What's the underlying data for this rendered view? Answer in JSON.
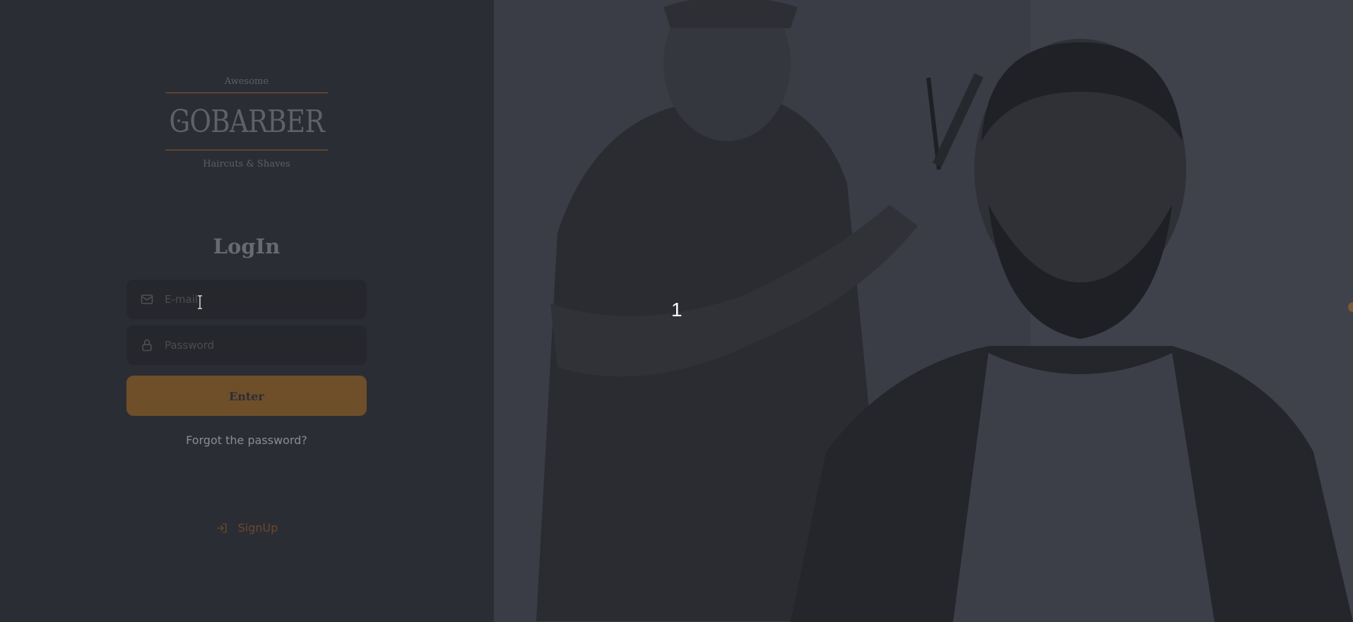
{
  "logo": {
    "top_text": "Awesome",
    "main_text": "GOBARBER",
    "bottom_text": "Haircuts & Shaves"
  },
  "login": {
    "title": "LogIn",
    "email_placeholder": "E-mail",
    "password_placeholder": "Password",
    "submit_label": "Enter",
    "forgot_label": "Forgot the password?",
    "signup_label": "SignUp"
  },
  "overlay": {
    "number": "1"
  },
  "colors": {
    "accent": "#ff9000",
    "accent_dimmed": "#6e4f2a",
    "left_bg": "#2b2d34",
    "input_bg": "#25272d"
  },
  "icons": {
    "email": "mail-icon",
    "password": "lock-icon",
    "signup": "log-in-icon"
  }
}
